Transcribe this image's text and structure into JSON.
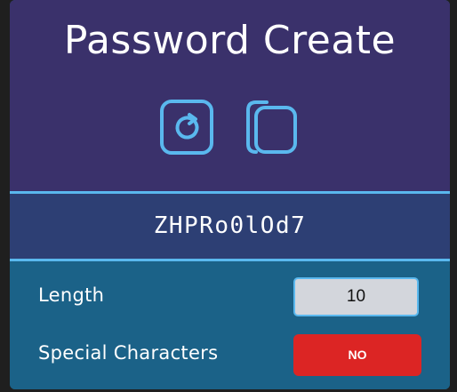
{
  "app": {
    "title": "Password Create"
  },
  "actions": {
    "regenerate_icon": "refresh-icon",
    "copy_icon": "copy-icon"
  },
  "password": {
    "value": "ZHPRo0lOd7"
  },
  "settings": {
    "length_label": "Length",
    "length_value": "10",
    "special_label": "Special Characters",
    "special_value": "NO"
  },
  "colors": {
    "header_bg": "#3a316b",
    "password_band_bg": "#2d3f74",
    "settings_bg": "#1b6288",
    "accent": "#5ab8ee",
    "toggle_off": "#dc2524",
    "input_bg": "#d3d6dc"
  }
}
